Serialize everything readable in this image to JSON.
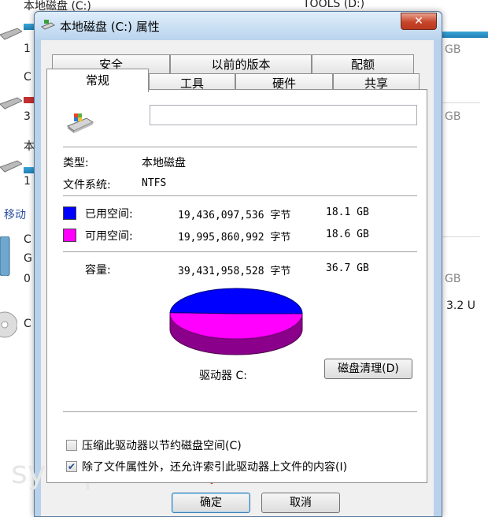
{
  "background": {
    "left_top_text": "本地磁盘 (C:)",
    "right_top_text": "TOOLS (D:)",
    "sizes": [
      "GB",
      "GB",
      "GB"
    ],
    "right_extra": "3.2 U",
    "left_labels": [
      "1",
      "C",
      "3",
      "本",
      "1",
      "移动",
      "C",
      "G",
      "0",
      "C"
    ],
    "colors": {
      "bar": "#2d8fc6",
      "bar_red": "#c33030"
    }
  },
  "dialog": {
    "title": "本地磁盘 (C:) 属性",
    "close_symbol": "✕",
    "tabs_top": [
      "安全",
      "以前的版本",
      "配额"
    ],
    "tabs_bottom": [
      "常规",
      "工具",
      "硬件",
      "共享"
    ],
    "active_tab": "常规",
    "general": {
      "name_value": "",
      "type_label": "类型:",
      "type_value": "本地磁盘",
      "fs_label": "文件系统:",
      "fs_value": "NTFS",
      "used": {
        "label": "已用空间:",
        "bytes": "19,436,097,536 字节",
        "size": "18.1 GB",
        "color": "#0000ff"
      },
      "free": {
        "label": "可用空间:",
        "bytes": "19,995,860,992 字节",
        "size": "18.6 GB",
        "color": "#ff00ff"
      },
      "capacity": {
        "label": "容量:",
        "bytes": "39,431,958,528 字节",
        "size": "36.7 GB"
      },
      "drive_label": "驱动器 C:",
      "cleanup_button": "磁盘清理(D)",
      "used_fraction": 0.493,
      "compress_label": "压缩此驱动器以节约磁盘空间(C)",
      "compress_checked": false,
      "index_label": "除了文件属性外，还允许索引此驱动器上文件的内容(I)",
      "index_checked": true
    },
    "buttons": {
      "ok": "确定",
      "cancel": "取消"
    },
    "watermark": "sy vip",
    "arrow_color": "#e0201e"
  }
}
